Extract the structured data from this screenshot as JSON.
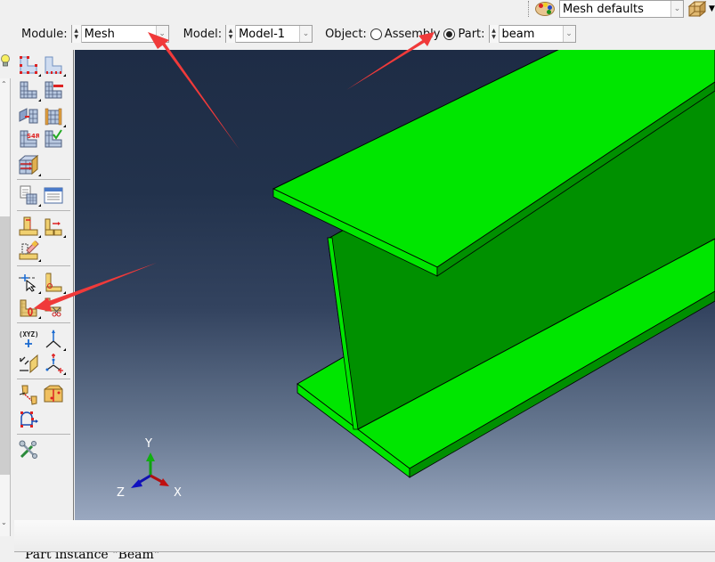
{
  "toolbar": {
    "render_style": {
      "icon": "color-palette-icon",
      "value": "Mesh defaults"
    },
    "view_icon": "wireframe-cube-icon"
  },
  "context": {
    "module_label": "Module:",
    "module_value": "Mesh",
    "model_label": "Model:",
    "model_value": "Model-1",
    "object_label": "Object:",
    "object_options": [
      {
        "label": "Assembly",
        "selected": false
      },
      {
        "label": "Part:",
        "selected": true
      }
    ],
    "part_value": "beam"
  },
  "toolbox": {
    "groups": [
      [
        "seed-part-icon",
        "seed-edges-icon"
      ],
      [
        "mesh-part-icon",
        "mesh-region-icon"
      ],
      [
        "assign-mesh-controls-icon",
        "assign-element-type-icon"
      ],
      [
        "element-type-s4r-icon",
        "verify-mesh-icon"
      ],
      [
        "assign-stack-direction-icon"
      ],
      [
        "create-mesh-part-icon",
        "mesh-query-icon"
      ],
      [
        "partition-face-icon",
        "partition-edge-icon"
      ],
      [
        "virtual-topology-icon"
      ],
      [
        "datum-point-icon",
        "datum-axis-icon"
      ],
      [
        "edit-mesh-icon",
        "delete-mesh-icon"
      ],
      [
        "datum-csys-icon",
        "datum-plane-icon"
      ],
      [
        "datum-offset-icon",
        "datum-display-icon"
      ],
      [
        "geometry-edit-icon",
        "repair-solid-icon"
      ],
      [
        "edge-loop-icon"
      ],
      [
        "tools-icon"
      ]
    ]
  },
  "viewport": {
    "part_color": "#00e600",
    "part_shade_color": "#009000",
    "triad": {
      "x": "X",
      "y": "Y",
      "z": "Z"
    },
    "annotations": [
      "red-arrow-to-module",
      "red-arrow-to-part-radio",
      "red-arrow-to-partition-tool"
    ]
  },
  "message_area": {
    "text": ""
  },
  "prompt": {
    "text": "                  Part instance  \"Beam\""
  }
}
